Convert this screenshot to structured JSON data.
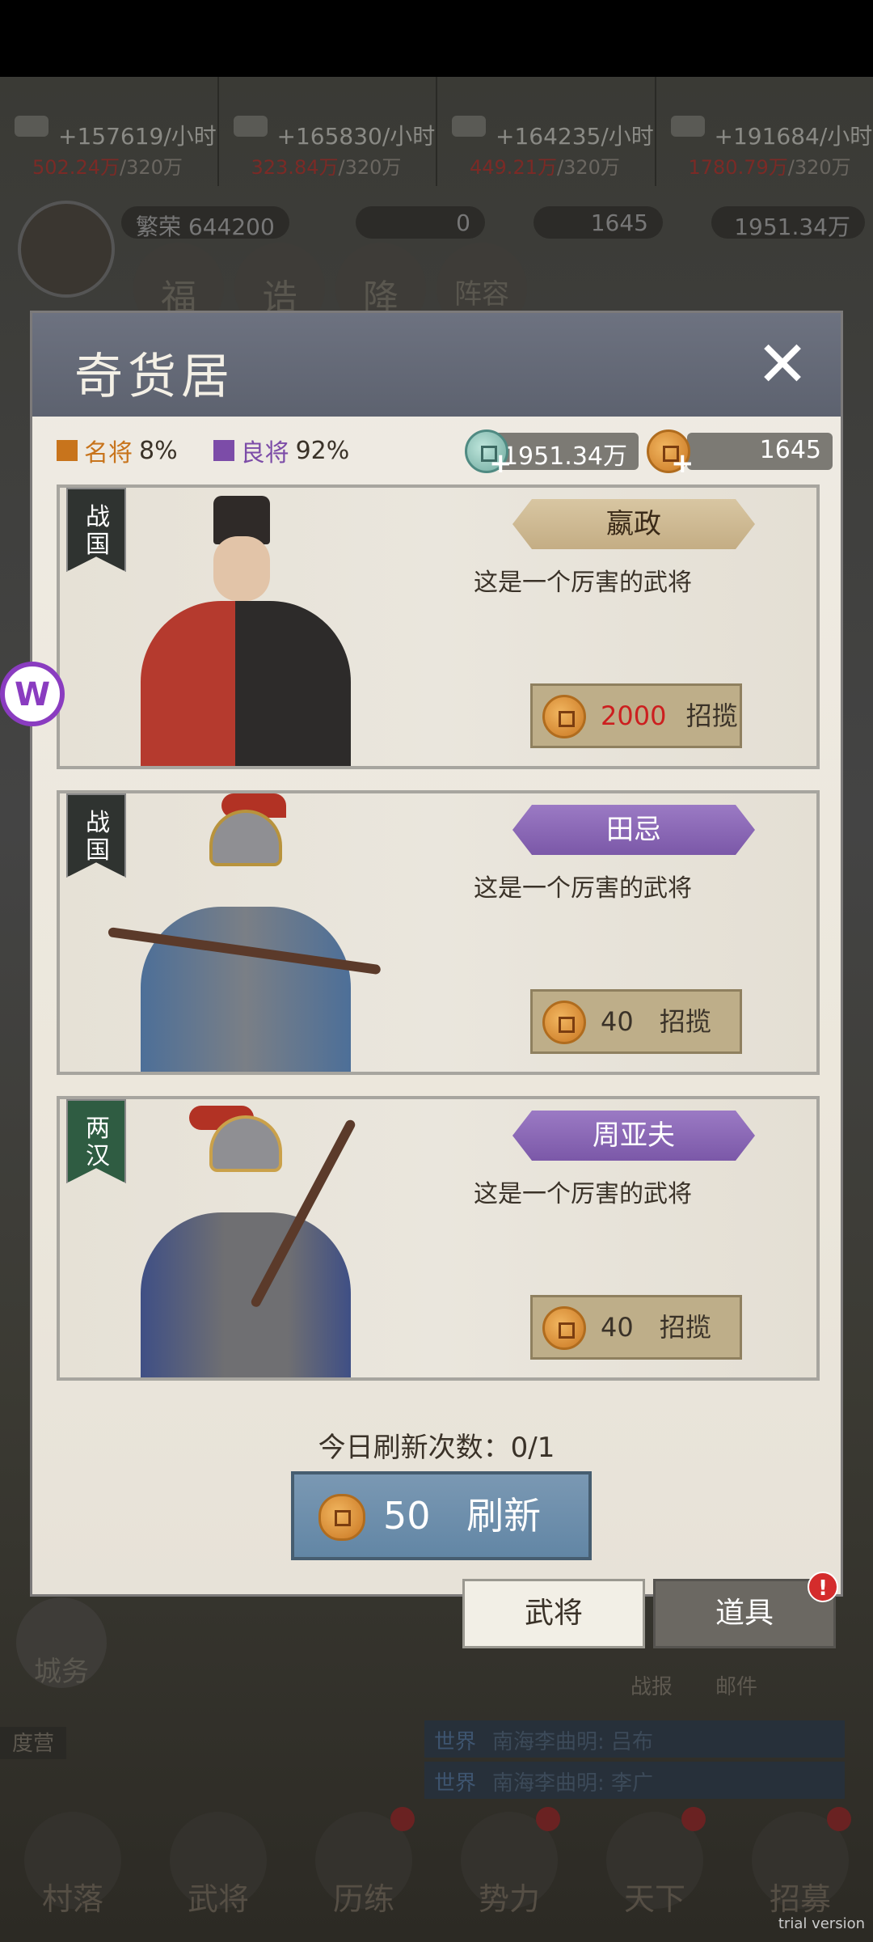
{
  "resources": [
    {
      "rate": "+157619/小时",
      "current": "502.24万",
      "cap": "/320万"
    },
    {
      "rate": "+165830/小时",
      "current": "323.84万",
      "cap": "/320万"
    },
    {
      "rate": "+164235/小时",
      "current": "449.21万",
      "cap": "/320万"
    },
    {
      "rate": "+191684/小时",
      "current": "1780.79万",
      "cap": "/320万"
    }
  ],
  "player": {
    "prosperity_label": "繁荣",
    "prosperity_value": "644200",
    "green_value": "0",
    "coins": "1645",
    "jade": "1951.34万"
  },
  "bg_buttons": [
    "福",
    "诰",
    "降",
    "阵容"
  ],
  "modal": {
    "title": "奇货居",
    "rates": [
      {
        "label": "名将",
        "value": "8%",
        "color": "#c8741c"
      },
      {
        "label": "良将",
        "value": "92%",
        "color": "#7c4ca8"
      }
    ],
    "jade": "1951.34万",
    "coins": "1645",
    "cards": [
      {
        "faction": "战国",
        "name": "嬴政",
        "tier": "gold",
        "desc": "这是一个厉害的武将",
        "cost": "2000",
        "cost_style": "red",
        "action": "招揽"
      },
      {
        "faction": "战国",
        "name": "田忌",
        "tier": "purple",
        "desc": "这是一个厉害的武将",
        "cost": "40",
        "cost_style": "normal",
        "action": "招揽"
      },
      {
        "faction": "两汉",
        "name": "周亚夫",
        "tier": "purple",
        "desc": "这是一个厉害的武将",
        "cost": "40",
        "cost_style": "normal",
        "action": "招揽"
      }
    ],
    "refresh_label": "今日刷新次数：",
    "refresh_count": "0/1",
    "refresh_cost": "50",
    "refresh_action": "刷新"
  },
  "tabs": {
    "generals": "武将",
    "items": "道具",
    "items_badge": "!"
  },
  "side_logo": "W",
  "chat": [
    {
      "channel": "世界",
      "text": "南海李曲明: 吕布"
    },
    {
      "channel": "世界",
      "text": "南海李曲明: 李广"
    }
  ],
  "bg_labels": {
    "city": "城务",
    "dispatch": "度营",
    "battle_report": "战报",
    "mail": "邮件"
  },
  "bottom_nav": [
    {
      "label": "村落",
      "badge": false
    },
    {
      "label": "武将",
      "badge": false
    },
    {
      "label": "历练",
      "badge": true
    },
    {
      "label": "势力",
      "badge": true
    },
    {
      "label": "天下",
      "badge": true
    },
    {
      "label": "招募",
      "badge": true
    }
  ],
  "watermark": "trial version"
}
